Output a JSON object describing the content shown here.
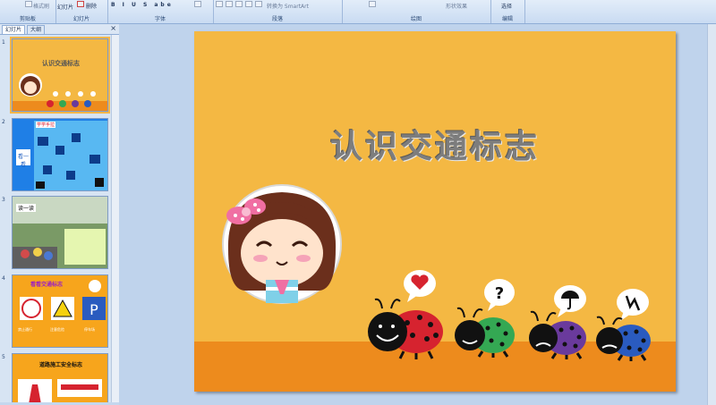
{
  "ribbon": {
    "groups": [
      {
        "label": "剪贴板",
        "text": "格式刷"
      },
      {
        "label": "幻灯片",
        "text": "幻灯片",
        "text2": "删除"
      },
      {
        "label": "字体",
        "text": "B I U S abe"
      },
      {
        "label": "段落",
        "text": "转换为 SmartArt"
      },
      {
        "label": "绘图",
        "text": "形状效果"
      },
      {
        "label": "编辑",
        "text": "选择"
      }
    ]
  },
  "panel": {
    "tabs": [
      "幻灯片",
      "大纲"
    ],
    "close": "×"
  },
  "thumbnails": [
    {
      "num": "1",
      "title": "认识交通标志",
      "colors": {
        "bg": "#f4b843",
        "ground": "#ed8b1d"
      }
    },
    {
      "num": "2",
      "label_a": "看一看",
      "label_b": "学学手拉",
      "colors": {
        "bg": "#1f7fe6"
      }
    },
    {
      "num": "3",
      "label": "读一读",
      "colors": {
        "bg": "#66904f"
      }
    },
    {
      "num": "4",
      "title": "看看交通标志",
      "labels": [
        "禁止通行",
        "注意危险",
        "停车场"
      ],
      "colors": {
        "bg": "#f7a51c"
      }
    },
    {
      "num": "5",
      "title": "道路施工安全标志",
      "colors": {
        "bg": "#f7a51c"
      }
    }
  ],
  "slide": {
    "title": "认识交通标志",
    "colors": {
      "background": "#f4b843",
      "ground": "#ed8b1d",
      "title": "#7d7d7d",
      "ladybug_red": "#d6232f",
      "ladybug_green": "#34a853",
      "ladybug_purple": "#6a3a9c",
      "ladybug_blue": "#2a5bbf"
    },
    "bubbles": [
      "heart-icon",
      "?",
      "umbrella-icon",
      "lightning-icon"
    ]
  }
}
